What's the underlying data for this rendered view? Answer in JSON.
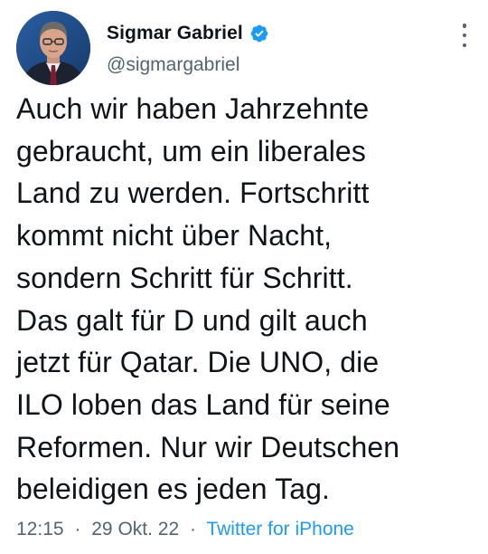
{
  "author": {
    "display_name": "Sigmar Gabriel",
    "handle": "@sigmargabriel",
    "verified": true,
    "verified_color": "#1d9bf0"
  },
  "tweet": {
    "lines": [
      "Auch wir haben Jahrzehnte",
      "gebraucht, um ein liberales",
      "Land zu werden. Fortschritt",
      "kommt nicht über Nacht,",
      "sondern Schritt für Schritt.",
      "Das galt für D und gilt auch",
      "jetzt für Qatar. Die UNO, die",
      "ILO loben das Land für seine",
      "Reformen. Nur wir Deutschen",
      "beleidigen es jeden Tag."
    ]
  },
  "meta": {
    "time": "12:15",
    "separator": "·",
    "date": "29 Okt. 22",
    "source": "Twitter for iPhone"
  },
  "icons": {
    "verified": "verified-badge-icon",
    "more": "more-options-icon"
  },
  "colors": {
    "text": "#0f1419",
    "secondary": "#536471",
    "link": "#1d9bf0"
  }
}
